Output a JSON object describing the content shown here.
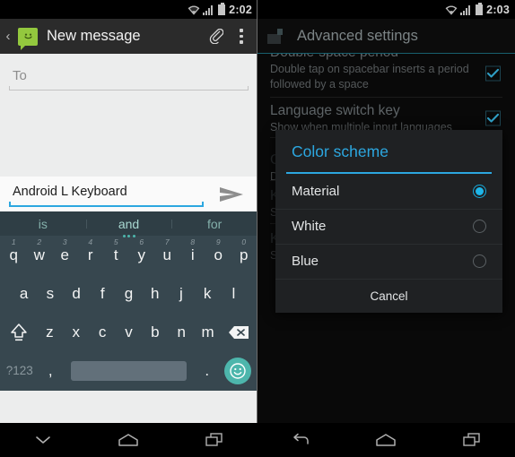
{
  "left": {
    "statusbar": {
      "time": "2:02",
      "icons": [
        "wifi-icon",
        "signal-icon",
        "battery-icon"
      ]
    },
    "appbar": {
      "back": "‹",
      "app_icon": "messaging-icon",
      "title": "New message",
      "attach_icon": "paperclip-icon",
      "overflow_icon": "overflow-menu-icon"
    },
    "compose": {
      "to_placeholder": "To",
      "message_value": "Android L Keyboard",
      "send_icon": "send-icon"
    },
    "keyboard": {
      "suggestions": [
        "is",
        "and",
        "for"
      ],
      "row1": [
        {
          "key": "q",
          "hint": "1"
        },
        {
          "key": "w",
          "hint": "2"
        },
        {
          "key": "e",
          "hint": "3"
        },
        {
          "key": "r",
          "hint": "4"
        },
        {
          "key": "t",
          "hint": "5"
        },
        {
          "key": "y",
          "hint": "6"
        },
        {
          "key": "u",
          "hint": "7"
        },
        {
          "key": "i",
          "hint": "8"
        },
        {
          "key": "o",
          "hint": "9"
        },
        {
          "key": "p",
          "hint": "0"
        }
      ],
      "row2": [
        "a",
        "s",
        "d",
        "f",
        "g",
        "h",
        "j",
        "k",
        "l"
      ],
      "row3": [
        "z",
        "x",
        "c",
        "v",
        "b",
        "n",
        "m"
      ],
      "shift_label": "shift-icon",
      "delete_label": "backspace-icon",
      "symbols_label": "?123",
      "comma_label": ",",
      "period_label": ".",
      "emoji_label": "emoji-icon",
      "accent": "#4db6ac"
    },
    "navbar": {
      "back_icon": "keyboard-dismiss-icon",
      "home_icon": "home-icon",
      "recents_icon": "recents-icon"
    }
  },
  "right": {
    "statusbar": {
      "time": "2:03",
      "icons": [
        "wifi-icon",
        "signal-icon",
        "battery-icon"
      ]
    },
    "appbar": {
      "icon": "keyboard-icon",
      "title": "Advanced settings"
    },
    "settings": [
      {
        "title": "Double-space period",
        "subtitle": "Double tap on spacebar inserts a period followed by a space",
        "checkbox": true
      },
      {
        "title": "Language switch key",
        "subtitle": "Show when multiple input languages are enabled",
        "checkbox": true
      },
      {
        "title": "Color scheme",
        "subtitle": "Default",
        "checkbox": false
      },
      {
        "title": "Keypress vibration duration",
        "subtitle": "System default",
        "checkbox": false
      },
      {
        "title": "Keypress sound volume",
        "subtitle": "System default",
        "checkbox": false
      }
    ],
    "dialog": {
      "title": "Color scheme",
      "options": [
        {
          "label": "Material",
          "selected": true
        },
        {
          "label": "White",
          "selected": false
        },
        {
          "label": "Blue",
          "selected": false
        }
      ],
      "cancel_label": "Cancel",
      "accent": "#2ca7e0"
    },
    "navbar": {
      "back_icon": "back-icon",
      "home_icon": "home-icon",
      "recents_icon": "recents-icon"
    }
  }
}
